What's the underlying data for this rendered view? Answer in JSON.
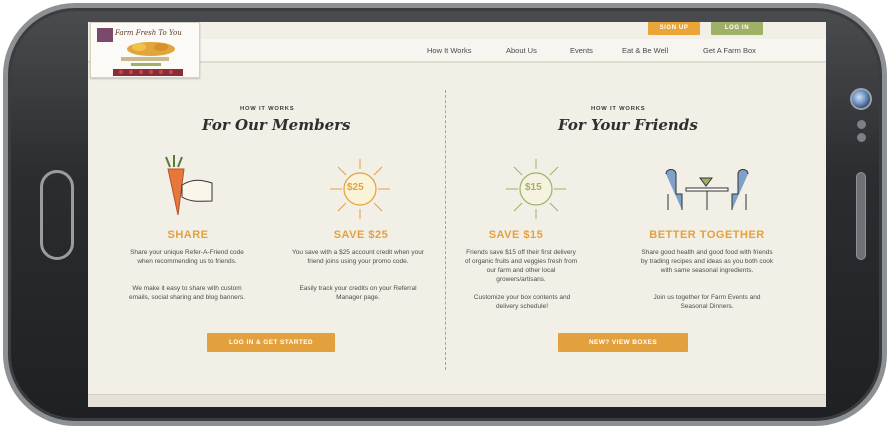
{
  "header": {
    "signup_label": "SIGN UP",
    "login_label": "LOG IN"
  },
  "logo": {
    "text": "Farm Fresh To You"
  },
  "nav": {
    "items": [
      "How It Works",
      "About Us",
      "Events",
      "Eat & Be Well",
      "Get A Farm Box"
    ]
  },
  "members": {
    "kicker": "HOW IT WORKS",
    "title": "For Our Members",
    "share": {
      "title": "SHARE",
      "text1": "Share your unique Refer-A-Friend code when recommending us to friends.",
      "text2": "We make it easy to share with custom emails, social sharing and blog banners."
    },
    "save25": {
      "badge": "$25",
      "title": "SAVE $25",
      "text1": "You save with a $25 account credit when your friend joins using your promo code.",
      "text2": "Easily track your credits on your Referral Manager page."
    },
    "cta": "LOG IN & GET STARTED"
  },
  "friends": {
    "kicker": "HOW IT WORKS",
    "title": "For Your Friends",
    "save15": {
      "badge": "$15",
      "title": "SAVE $15",
      "text1": "Friends save $15 off their first delivery of organic fruits and veggies fresh from our farm and other local growers/artisans.",
      "text2": "Customize your box contents and delivery schedule!"
    },
    "together": {
      "title": "BETTER TOGETHER",
      "text1": "Share good health and good food with friends by trading recipes and ideas as you both cook with same seasonal ingredients.",
      "text2": "Join us together for Farm Events and Seasonal Dinners."
    },
    "cta": "NEW? VIEW BOXES"
  },
  "colors": {
    "accent": "#e3a13e",
    "login": "#9fb167",
    "background": "#f2efe7"
  }
}
